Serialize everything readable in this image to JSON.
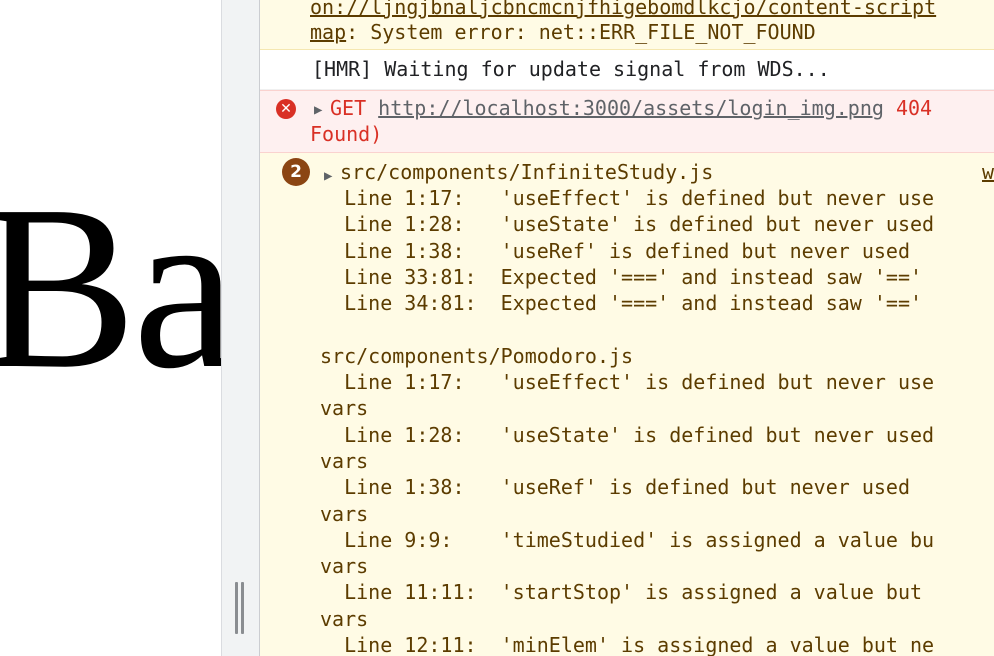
{
  "page": {
    "big_text": "Ba"
  },
  "console": {
    "top_warning": {
      "line1": "on://ljngjbnaljcbncmcnjfhigebomdlkcjo/content-script",
      "line2_link": "map",
      "line2_text": ": System error: net::ERR_FILE_NOT_FOUND"
    },
    "info": {
      "text": "[HMR] Waiting for update signal from WDS..."
    },
    "error": {
      "method": "GET",
      "url": "http://localhost:3000/assets/login_img.png",
      "status": "404",
      "continuation": "Found)"
    },
    "warning": {
      "count": "2",
      "header": "src/components/InfiniteStudy.js",
      "source_link": "w",
      "lines": [
        "  Line 1:17:   'useEffect' is defined but never use",
        "  Line 1:28:   'useState' is defined but never used",
        "  Line 1:38:   'useRef' is defined but never used",
        "  Line 33:81:  Expected '===' and instead saw '=='",
        "  Line 34:81:  Expected '===' and instead saw '=='",
        "",
        "src/components/Pomodoro.js",
        "  Line 1:17:   'useEffect' is defined but never use",
        "vars",
        "  Line 1:28:   'useState' is defined but never used",
        "vars",
        "  Line 1:38:   'useRef' is defined but never used",
        "vars",
        "  Line 9:9:    'timeStudied' is assigned a value bu",
        "vars",
        "  Line 11:11:  'startStop' is assigned a value but",
        "vars",
        "  Line 12:11:  'minElem' is assigned a value but ne"
      ]
    }
  },
  "colors": {
    "warning_bg": "#fffbe5",
    "warning_text": "#5c3c00",
    "error_bg": "#fef0f0",
    "error_text": "#d93025",
    "badge": "#8b4513"
  }
}
